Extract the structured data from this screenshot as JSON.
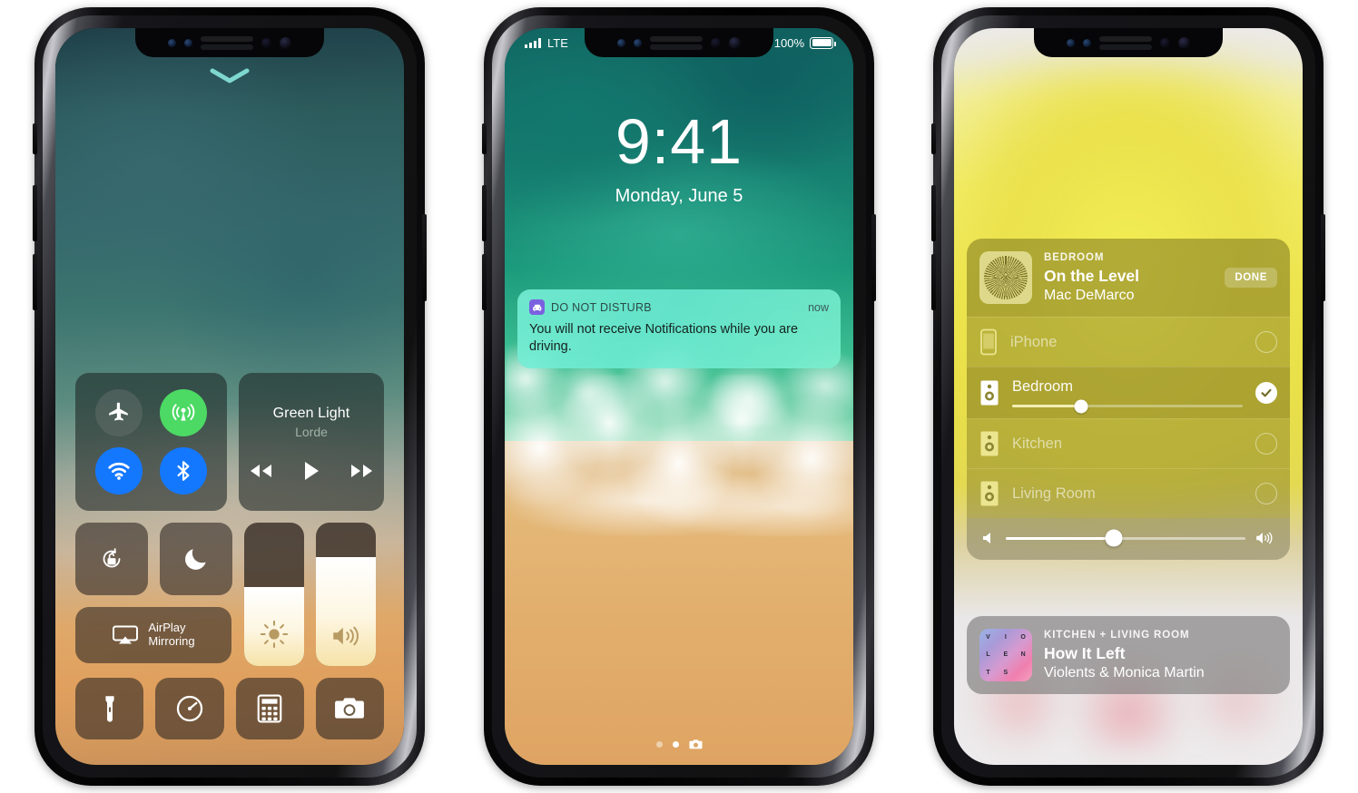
{
  "meta": {
    "scene": "Three iPhone X mockups: Control Center, Lock Screen, AirPlay panel",
    "accent_green": "#4cd964",
    "accent_blue": "#1478ff",
    "notification_teal": "#78f0d7",
    "airplay_yellow": "#eee64d"
  },
  "phone1": {
    "name": "Control Center",
    "chevron": "chevron-down-icon",
    "toggles": [
      {
        "name": "airplane-mode",
        "icon": "airplane-icon",
        "state": "off"
      },
      {
        "name": "cellular-data",
        "icon": "cellular-antenna-icon",
        "state": "on"
      },
      {
        "name": "wifi",
        "icon": "wifi-icon",
        "state": "on"
      },
      {
        "name": "bluetooth",
        "icon": "bluetooth-icon",
        "state": "on"
      }
    ],
    "media": {
      "title": "Green Light",
      "artist": "Lorde",
      "controls": [
        "rewind-icon",
        "play-icon",
        "fast-forward-icon"
      ]
    },
    "quick": [
      {
        "name": "rotation-lock",
        "icon": "rotation-lock-icon"
      },
      {
        "name": "do-not-disturb",
        "icon": "moon-icon"
      }
    ],
    "airplay": {
      "line1": "AirPlay",
      "line2": "Mirroring",
      "icon": "airplay-icon"
    },
    "sliders": [
      {
        "name": "brightness",
        "icon": "brightness-sun-icon",
        "value": 55
      },
      {
        "name": "volume",
        "icon": "speaker-waves-icon",
        "value": 76
      }
    ],
    "apps": [
      {
        "name": "flashlight",
        "icon": "flashlight-icon"
      },
      {
        "name": "timer",
        "icon": "timer-icon"
      },
      {
        "name": "calculator",
        "icon": "calculator-icon"
      },
      {
        "name": "camera",
        "icon": "camera-icon"
      }
    ]
  },
  "phone2": {
    "name": "Lock Screen",
    "statusbar": {
      "signal": "signal-bars-icon",
      "carrier": "LTE",
      "battery_percent": "100%",
      "battery_icon": "battery-full-icon"
    },
    "time": "9:41",
    "date": "Monday, June 5",
    "notification": {
      "app_icon": "car-icon",
      "app": "DO NOT DISTURB",
      "timestamp": "now",
      "body": "You will not receive Notifications while you are driving."
    },
    "bottom": {
      "page_dots": 2,
      "active_dot": 2,
      "camera_icon": "camera-icon"
    }
  },
  "phone3": {
    "name": "AirPlay",
    "now_playing": {
      "room": "BEDROOM",
      "track": "On the Level",
      "artist": "Mac DeMarco",
      "done_label": "DONE",
      "artwork": "album-art-on-the-level"
    },
    "devices": [
      {
        "name": "iPhone",
        "icon": "iphone-icon",
        "selected": false,
        "has_slider": false
      },
      {
        "name": "Bedroom",
        "icon": "speaker-icon",
        "selected": true,
        "has_slider": true,
        "volume": 30
      },
      {
        "name": "Kitchen",
        "icon": "speaker-icon",
        "selected": false,
        "has_slider": false
      },
      {
        "name": "Living Room",
        "icon": "speaker-icon",
        "selected": false,
        "has_slider": false
      }
    ],
    "master_volume": {
      "low_icon": "speaker-low-icon",
      "high_icon": "speaker-high-icon",
      "value": 45
    },
    "second_card": {
      "room": "KITCHEN + LIVING ROOM",
      "track": "How It Left",
      "artist": "Violents & Monica Martin",
      "artwork_letters": [
        "V",
        "I",
        "O",
        "L",
        "E",
        "N",
        "T",
        "S",
        ""
      ]
    }
  }
}
